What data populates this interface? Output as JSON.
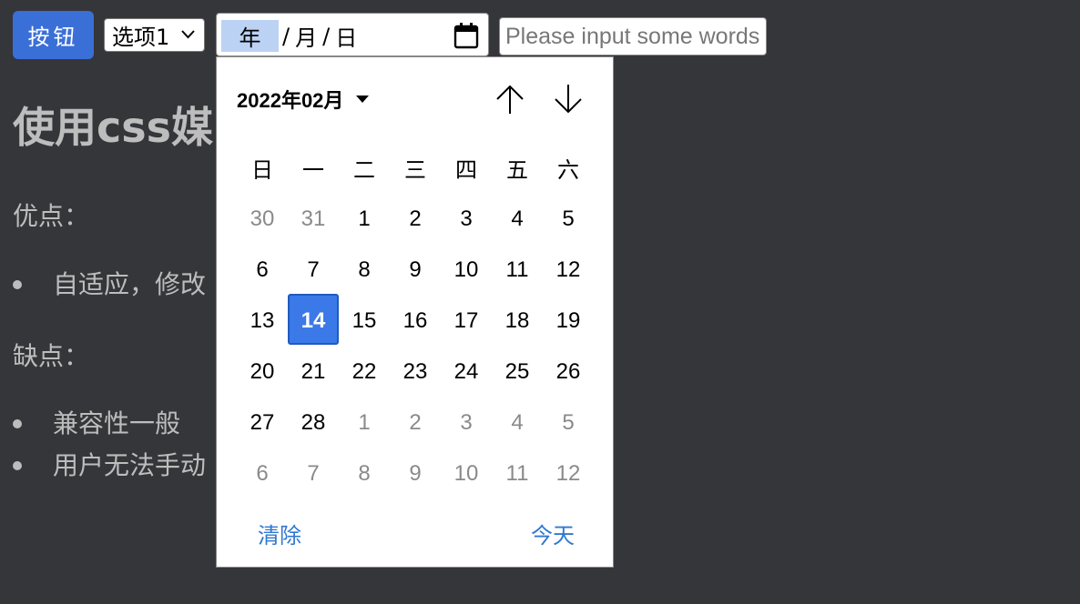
{
  "toolbar": {
    "button_label": "按钮",
    "select_value": "选项1",
    "date_input": {
      "year_seg": "年",
      "sep1": "/",
      "month_seg": "月",
      "sep2": "/",
      "day_seg": "日"
    },
    "text_input_placeholder": "Please input some words"
  },
  "content": {
    "title": "使用css媒",
    "pros_label": "优点：",
    "pros": [
      "自适应，修改"
    ],
    "cons_label": "缺点：",
    "cons": [
      "兼容性一般",
      "用户无法手动"
    ]
  },
  "picker": {
    "month_label": "2022年02月",
    "weekdays": [
      "日",
      "一",
      "二",
      "三",
      "四",
      "五",
      "六"
    ],
    "weeks": [
      [
        "30",
        "31",
        "1",
        "2",
        "3",
        "4",
        "5"
      ],
      [
        "6",
        "7",
        "8",
        "9",
        "10",
        "11",
        "12"
      ],
      [
        "13",
        "14",
        "15",
        "16",
        "17",
        "18",
        "19"
      ],
      [
        "20",
        "21",
        "22",
        "23",
        "24",
        "25",
        "26"
      ],
      [
        "27",
        "28",
        "1",
        "2",
        "3",
        "4",
        "5"
      ],
      [
        "6",
        "7",
        "8",
        "9",
        "10",
        "11",
        "12"
      ]
    ],
    "selected_day": "14",
    "clear_label": "清除",
    "today_label": "今天"
  },
  "colors": {
    "background": "#35363a",
    "button": "#3b6fd8",
    "selected_day": "#3b79e8",
    "link": "#2f78d0",
    "year_highlight": "#bcd2f4"
  }
}
